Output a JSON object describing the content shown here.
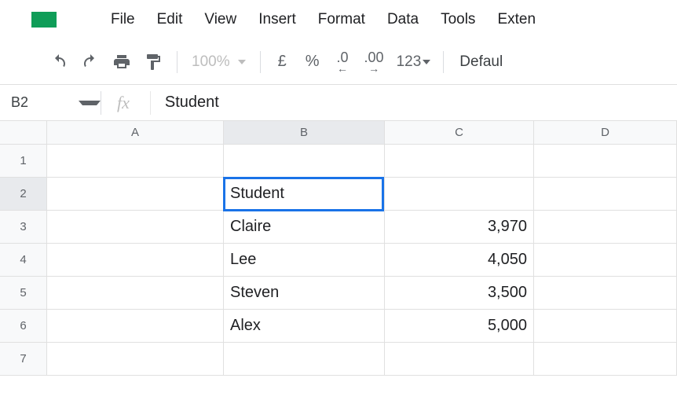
{
  "menu": {
    "items": [
      "File",
      "Edit",
      "View",
      "Insert",
      "Format",
      "Data",
      "Tools",
      "Exten"
    ]
  },
  "toolbar": {
    "zoom": "100%",
    "currency": "£",
    "percent": "%",
    "dec_less": ".0",
    "dec_more": ".00",
    "more_formats": "123",
    "font": "Defaul"
  },
  "namebox": {
    "ref": "B2",
    "fx": "fx",
    "formula": "Student"
  },
  "columns": [
    "A",
    "B",
    "C",
    "D"
  ],
  "selected_col_index": 1,
  "selected_row": 2,
  "rows": [
    {
      "n": "1",
      "b": "",
      "c": ""
    },
    {
      "n": "2",
      "b": "Student",
      "c": ""
    },
    {
      "n": "3",
      "b": "Claire",
      "c": "3,970"
    },
    {
      "n": "4",
      "b": "Lee",
      "c": "4,050"
    },
    {
      "n": "5",
      "b": "Steven",
      "c": "3,500"
    },
    {
      "n": "6",
      "b": "Alex",
      "c": "5,000"
    },
    {
      "n": "7",
      "b": "",
      "c": ""
    }
  ]
}
